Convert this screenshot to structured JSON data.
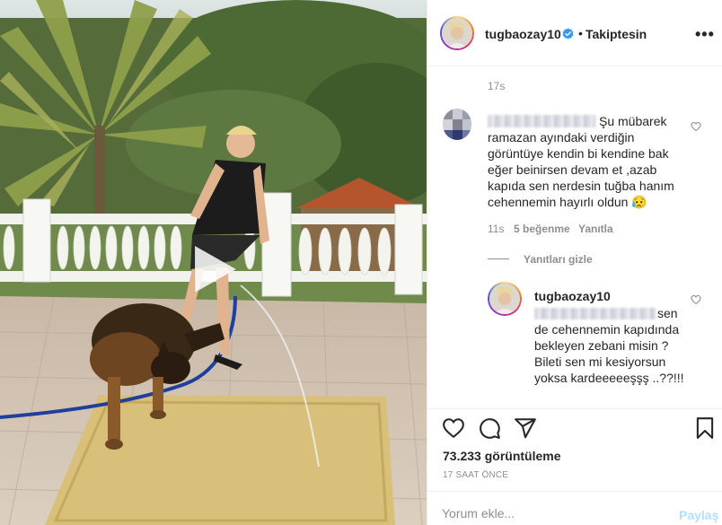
{
  "post": {
    "views_text": "73.233 görüntüleme",
    "posted_ago": "17 SAAT ÖNCE"
  },
  "header": {
    "username": "tugbaozay10",
    "separator": "•",
    "follow_status": "Takiptesin",
    "more": "•••"
  },
  "thread": {
    "top_time": "17s",
    "comment": {
      "text": "Şu mübarek ramazan ayındaki verdiğin görüntüye kendin bi kendine bak eğer beinirsen devam et ,azab kapıda sen nerdesin tuğba hanım cehennemin hayırlı oldun 😥",
      "time": "11s",
      "likes": "5 beğenme",
      "reply_label": "Yanıtla"
    },
    "hide_replies": "Yanıtları gizle",
    "reply": {
      "username": "tugbaozay10",
      "text": "sen de cehennemin kapıdında bekleyen zebani misin ? Bileti sen mi kesiyorsun yoksa kardeeeeeşşş ..??!!!"
    }
  },
  "composer": {
    "placeholder": "Yorum ekle...",
    "post_label": "Paylaş"
  },
  "icons": {
    "like": "heart-icon",
    "comment": "comment-icon",
    "share": "paper-plane-icon",
    "save": "bookmark-icon",
    "verified": "verified-badge-icon",
    "play": "play-icon"
  },
  "colors": {
    "verified": "#3897f0",
    "muted": "#8e8e8e",
    "post_button": "#b2dffc"
  }
}
